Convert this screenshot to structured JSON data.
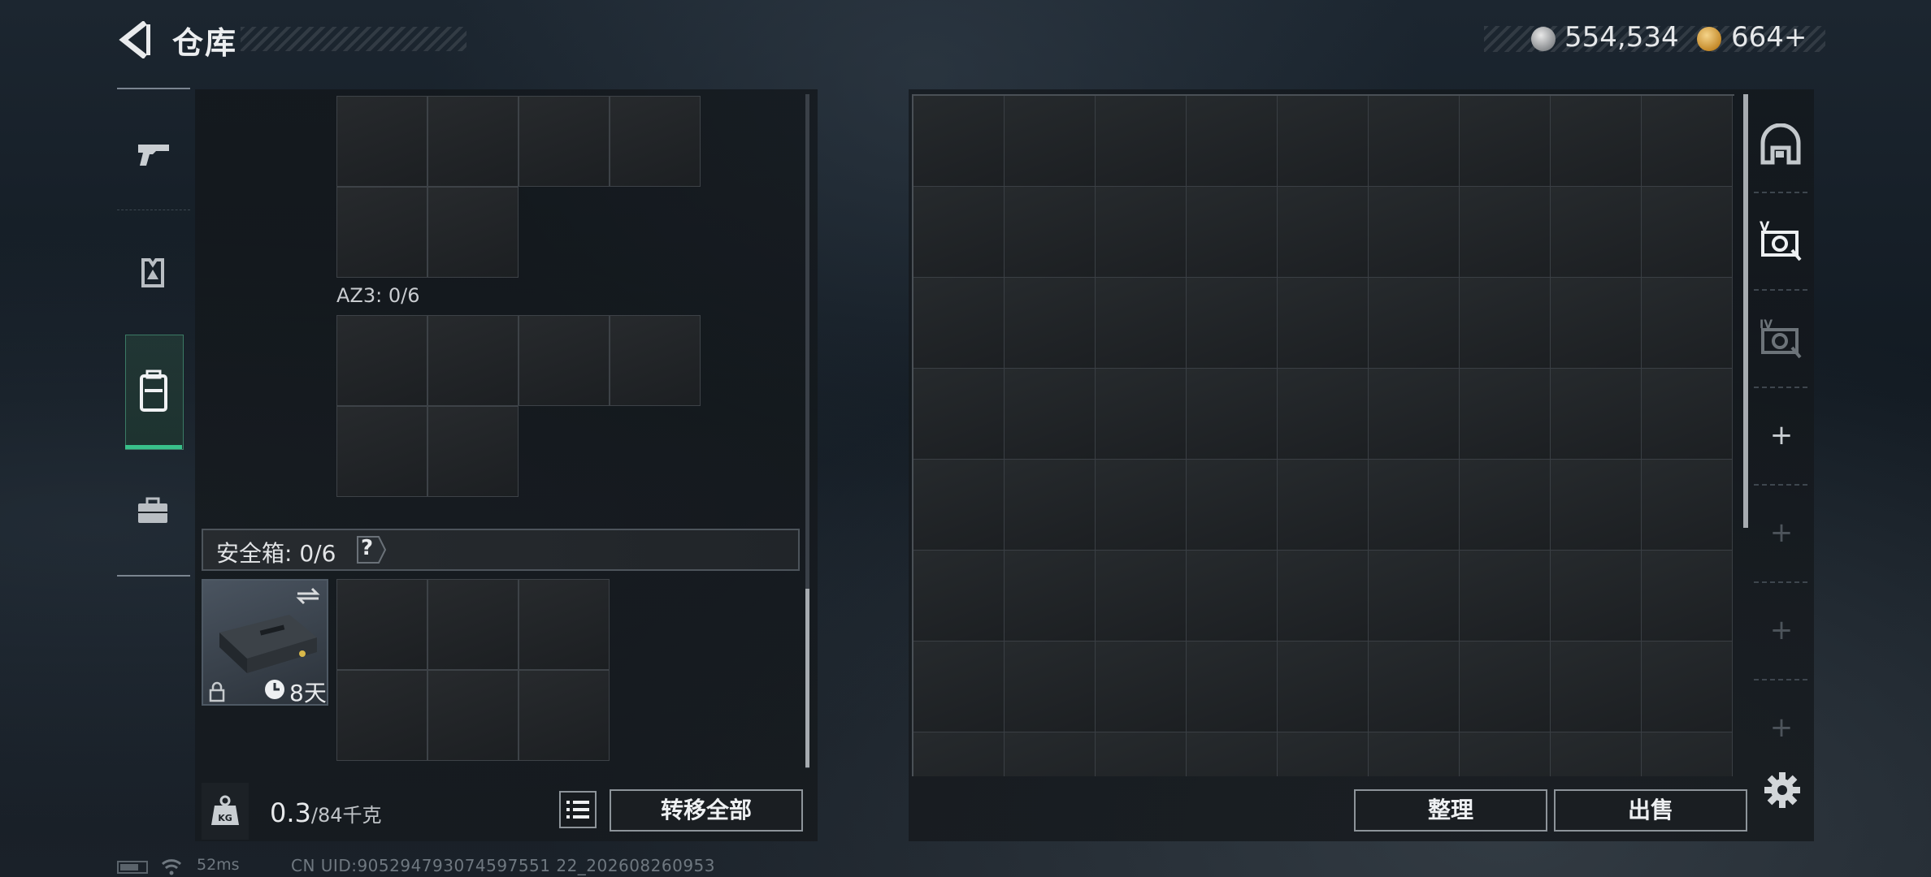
{
  "header": {
    "title": "仓库",
    "currency_silver": "554,534",
    "currency_gold": "664+",
    "colors": {
      "accent_green": "#39c08a",
      "panel_border": "#8d949a"
    }
  },
  "nav": {
    "items": [
      {
        "icon": "pistol-icon"
      },
      {
        "icon": "armor-vest-icon"
      },
      {
        "icon": "backpack-icon",
        "selected": true
      },
      {
        "icon": "briefcase-icon"
      }
    ]
  },
  "left": {
    "az3_label": "AZ3: 0/6",
    "safe_box_label": "安全箱: 0/6",
    "safe_box_help": "?",
    "safe_box_days": "8天",
    "weight_current": "0.3",
    "weight_max": "/84千克",
    "weight_icon_text": "KG",
    "transfer_all": "转移全部"
  },
  "right": {
    "sort_button": "整理",
    "sell_button": "出售",
    "side_tabs": [
      "storage-arch-icon",
      "stash-v-icon",
      "stash-iv-icon",
      "add-icon",
      "add-icon",
      "add-icon",
      "add-icon"
    ]
  },
  "status": {
    "ping": "52ms",
    "uid": "CN UID:905294793074597551 22_202608260953"
  }
}
